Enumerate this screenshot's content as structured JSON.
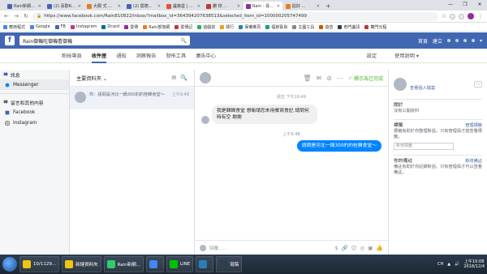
{
  "browser": {
    "tabs": [
      {
        "title": "Rain新網誌粉絲專頁",
        "color": "#4267b2",
        "active": false
      },
      {
        "title": "(2) 喜歡R...",
        "color": "#4267b2",
        "active": false
      },
      {
        "title": "大關 式 ...",
        "color": "#e67e22",
        "active": false
      },
      {
        "title": "(2) 雲德...",
        "color": "#4267b2",
        "active": false
      },
      {
        "title": "盧森堡 | 富貴 ...",
        "color": "#e74c3c",
        "active": false
      },
      {
        "title": "鑽 校 ...",
        "color": "#c0392b",
        "active": false
      },
      {
        "title": "Rain - 尋...",
        "color": "#8e2d9c",
        "active": true
      },
      {
        "title": "貼好 ...",
        "color": "#e67e22",
        "active": false
      }
    ],
    "new_tab": "+",
    "window_controls": [
      "—",
      "❐",
      "✕"
    ],
    "url": "https://www.facebook.com/Rain810822/inbox/?mailbox_id=364394207638513&selected_item_id=100000205747499",
    "bookmarks": [
      {
        "label": "應用程式",
        "color": "#4285f4"
      },
      {
        "label": "Google",
        "color": "#4285f4"
      },
      {
        "label": "FB",
        "color": "#4267b2"
      },
      {
        "label": "Instagram",
        "color": "#c13584"
      },
      {
        "label": "Dcard",
        "color": "#006aa6"
      },
      {
        "label": "愛傳",
        "color": "#8e2d9c"
      },
      {
        "label": "Rain部落網",
        "color": "#e67e22"
      },
      {
        "label": "愛傳記",
        "color": "#c0392b"
      },
      {
        "label": "遊戲前",
        "color": "#27ae60"
      },
      {
        "label": "標行",
        "color": "#f39c12"
      },
      {
        "label": "保備推頁",
        "color": "#2980b9"
      },
      {
        "label": "福斯賓易",
        "color": "#16a085"
      },
      {
        "label": "主圖工具",
        "color": "#7f8c8d"
      },
      {
        "label": "遊音",
        "color": "#d35400"
      },
      {
        "label": "奇門盧訊",
        "color": "#2c3e50"
      },
      {
        "label": "蘿門元程",
        "color": "#c0392b"
      }
    ]
  },
  "fb": {
    "logo": "f",
    "search_value": "Rain御機吃御機看御機",
    "top_right": [
      "首頁",
      "建立"
    ],
    "page_nav": [
      "粉絲專頁",
      "收件匣",
      "通知",
      "洞察報告",
      "發佈工具",
      "廣告中心"
    ],
    "page_nav_right": [
      "設定",
      "使用說明 ▾"
    ]
  },
  "sidebar": {
    "section1": "訊息",
    "items": [
      "Messenger"
    ],
    "section2": "留言和其他內容",
    "items2": [
      "Facebook",
      "Instagram"
    ]
  },
  "convlist": {
    "header": "主要資料夾",
    "chevron": "⌄",
    "item": {
      "time": "上午9:48",
      "preview": "你：請問是河北一鍋300的的桂韓食堂～"
    }
  },
  "chat": {
    "done_label": "標示為已完成",
    "ts1": "週五 下午10:49",
    "incoming": "我是韓韓食堂 想衛請您來用餐寫食記 請問何時有空 謝謝",
    "ts2": "上午9:48",
    "outgoing": "請問是河北一鍋300的的桂韓食堂～",
    "placeholder": "回覆……"
  },
  "info": {
    "view_profile": "查看個人檔案",
    "more": "···",
    "activity_title": "關於",
    "activity_text": "沒有公開資料",
    "labels_title": "標籤",
    "labels_action": "管理標籤",
    "labels_text": "標籤有助於你整理對話。只有管理員才能查看標籤。",
    "labels_placeholder": "新增標籤",
    "notes_title": "你的備註",
    "notes_action": "新增備註",
    "notes_text": "備註有助於你記錄對話。只有管理員才可以查看備註。"
  },
  "taskbar": {
    "items": [
      {
        "label": "10/1129...",
        "color": "#f1c40f"
      },
      {
        "label": "新鏈資料夾",
        "color": "#f1c40f"
      },
      {
        "label": "Rain新網...",
        "color": "#2ecc71"
      },
      {
        "label": "",
        "color": "#4285f4"
      },
      {
        "label": "LINE",
        "color": "#00c300"
      },
      {
        "label": "",
        "color": "#2980b9"
      },
      {
        "label": "寫稿",
        "color": "#2c3e50"
      }
    ],
    "tray": "CH",
    "time": "上午10:08",
    "date": "2018/12/4"
  }
}
